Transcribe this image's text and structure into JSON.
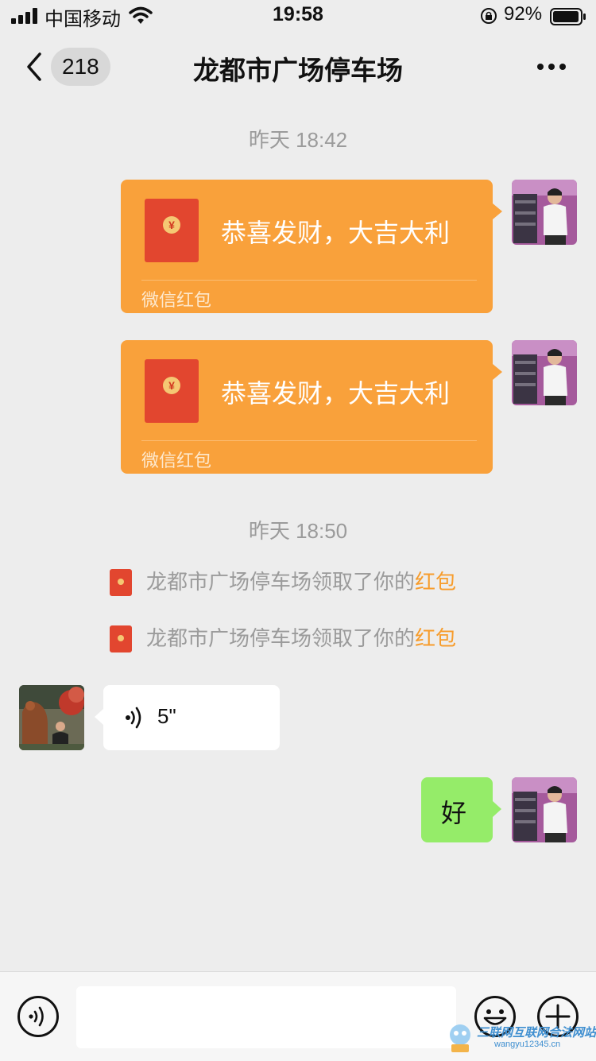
{
  "status_bar": {
    "carrier": "中国移动",
    "time": "19:58",
    "battery_percent": "92%"
  },
  "nav": {
    "back_count": "218",
    "title": "龙都市广场停车场",
    "more_icon": "more-dots-icon"
  },
  "messages": {
    "timestamp_1": "昨天 18:42",
    "red_packet_1": {
      "wish": "恭喜发财，大吉大利",
      "label": "微信红包"
    },
    "red_packet_2": {
      "wish": "恭喜发财，大吉大利",
      "label": "微信红包"
    },
    "timestamp_2": "昨天 18:50",
    "notice_1": {
      "text": "龙都市广场停车场领取了你的",
      "link": "红包"
    },
    "notice_2": {
      "text": "龙都市广场停车场领取了你的",
      "link": "红包"
    },
    "voice": {
      "duration": "5\""
    },
    "text_reply": "好"
  },
  "input_bar": {
    "voice_icon": "voice-toggle-icon",
    "emoji_icon": "emoji-icon",
    "plus_icon": "plus-icon",
    "value": ""
  },
  "watermark": {
    "text": "三联网互联网合法网站",
    "url": "wangyu12345.cn"
  },
  "colors": {
    "background": "#ededed",
    "red_packet": "#f9a13b",
    "my_bubble": "#95ec69",
    "link_orange": "#f79c2b"
  }
}
